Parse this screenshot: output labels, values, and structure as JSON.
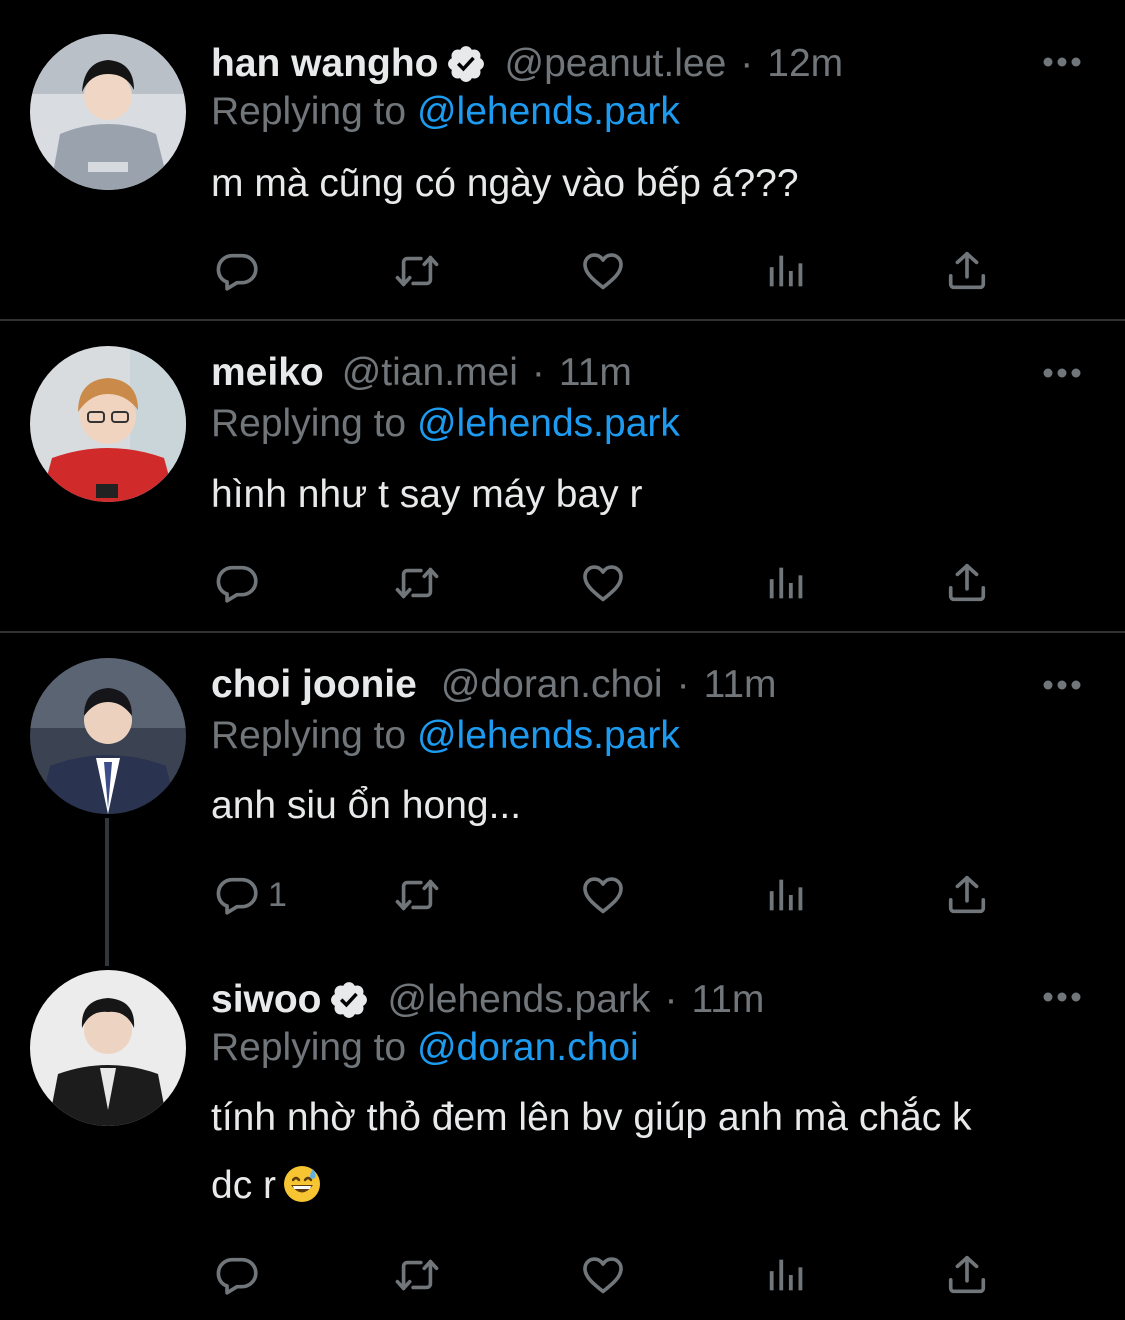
{
  "tweets": [
    {
      "name": "han wangho",
      "handle": "@peanut.lee",
      "time": "12m",
      "verified": true,
      "reply_prefix": "Replying to",
      "reply_to": "@lehends.park",
      "text": "m mà cũng có ngày vào bếp á???",
      "reply_count": ""
    },
    {
      "name": "meiko",
      "handle": "@tian.mei",
      "time": "11m",
      "verified": false,
      "reply_prefix": "Replying to",
      "reply_to": "@lehends.park",
      "text": "hình như t say máy bay r",
      "reply_count": ""
    },
    {
      "name": "choi joonie",
      "handle": "@doran.choi",
      "time": "11m",
      "verified": false,
      "reply_prefix": "Replying to",
      "reply_to": "@lehends.park",
      "text": "anh siu ổn hong...",
      "reply_count": "1"
    },
    {
      "name": "siwoo",
      "handle": "@lehends.park",
      "time": "11m",
      "verified": true,
      "reply_prefix": "Replying to",
      "reply_to": "@doran.choi",
      "text_line1": "tính nhờ thỏ đem lên bv giúp anh mà chắc k",
      "text_line2": "dc r",
      "reply_count": ""
    }
  ],
  "separator": "·",
  "icons": {
    "reply": "reply-icon",
    "retweet": "retweet-icon",
    "like": "heart-icon",
    "views": "views-icon",
    "share": "share-icon",
    "more": "more-icon",
    "verified": "verified-badge-icon",
    "emoji": "grinning-sweat-emoji"
  },
  "colors": {
    "background": "#000000",
    "text": "#e7e9ea",
    "muted": "#71767b",
    "link": "#1d9bf0",
    "divider": "#2f3336"
  }
}
